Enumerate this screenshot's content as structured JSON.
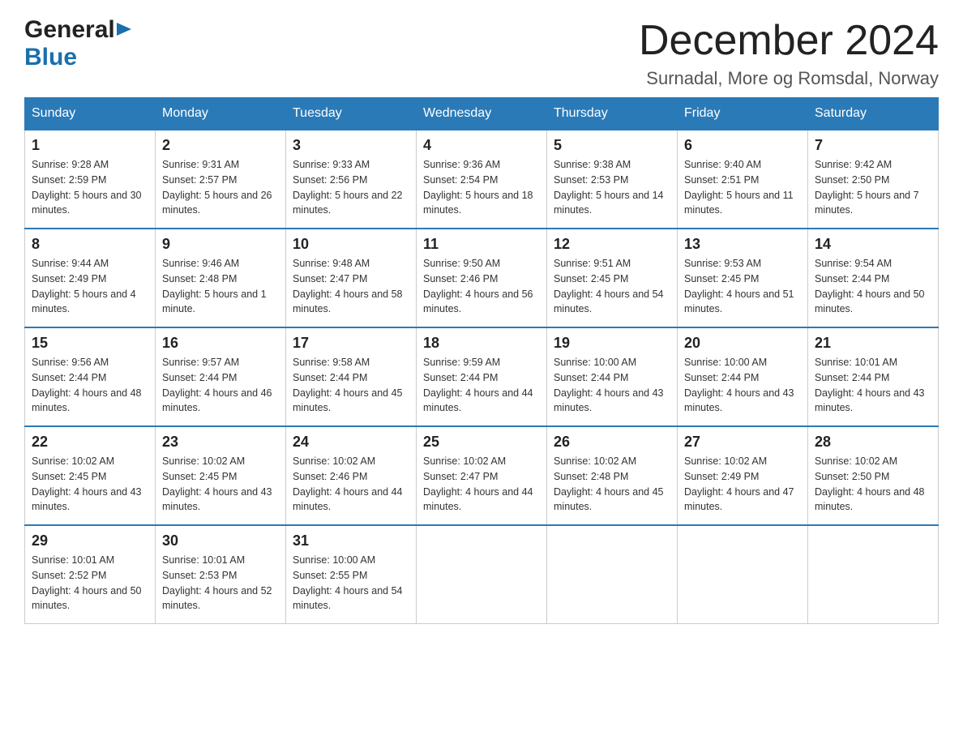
{
  "header": {
    "logo_part1": "General",
    "logo_part2": "Blue",
    "month_title": "December 2024",
    "location": "Surnadal, More og Romsdal, Norway"
  },
  "weekdays": [
    "Sunday",
    "Monday",
    "Tuesday",
    "Wednesday",
    "Thursday",
    "Friday",
    "Saturday"
  ],
  "weeks": [
    [
      {
        "day": "1",
        "sunrise": "9:28 AM",
        "sunset": "2:59 PM",
        "daylight": "5 hours and 30 minutes."
      },
      {
        "day": "2",
        "sunrise": "9:31 AM",
        "sunset": "2:57 PM",
        "daylight": "5 hours and 26 minutes."
      },
      {
        "day": "3",
        "sunrise": "9:33 AM",
        "sunset": "2:56 PM",
        "daylight": "5 hours and 22 minutes."
      },
      {
        "day": "4",
        "sunrise": "9:36 AM",
        "sunset": "2:54 PM",
        "daylight": "5 hours and 18 minutes."
      },
      {
        "day": "5",
        "sunrise": "9:38 AM",
        "sunset": "2:53 PM",
        "daylight": "5 hours and 14 minutes."
      },
      {
        "day": "6",
        "sunrise": "9:40 AM",
        "sunset": "2:51 PM",
        "daylight": "5 hours and 11 minutes."
      },
      {
        "day": "7",
        "sunrise": "9:42 AM",
        "sunset": "2:50 PM",
        "daylight": "5 hours and 7 minutes."
      }
    ],
    [
      {
        "day": "8",
        "sunrise": "9:44 AM",
        "sunset": "2:49 PM",
        "daylight": "5 hours and 4 minutes."
      },
      {
        "day": "9",
        "sunrise": "9:46 AM",
        "sunset": "2:48 PM",
        "daylight": "5 hours and 1 minute."
      },
      {
        "day": "10",
        "sunrise": "9:48 AM",
        "sunset": "2:47 PM",
        "daylight": "4 hours and 58 minutes."
      },
      {
        "day": "11",
        "sunrise": "9:50 AM",
        "sunset": "2:46 PM",
        "daylight": "4 hours and 56 minutes."
      },
      {
        "day": "12",
        "sunrise": "9:51 AM",
        "sunset": "2:45 PM",
        "daylight": "4 hours and 54 minutes."
      },
      {
        "day": "13",
        "sunrise": "9:53 AM",
        "sunset": "2:45 PM",
        "daylight": "4 hours and 51 minutes."
      },
      {
        "day": "14",
        "sunrise": "9:54 AM",
        "sunset": "2:44 PM",
        "daylight": "4 hours and 50 minutes."
      }
    ],
    [
      {
        "day": "15",
        "sunrise": "9:56 AM",
        "sunset": "2:44 PM",
        "daylight": "4 hours and 48 minutes."
      },
      {
        "day": "16",
        "sunrise": "9:57 AM",
        "sunset": "2:44 PM",
        "daylight": "4 hours and 46 minutes."
      },
      {
        "day": "17",
        "sunrise": "9:58 AM",
        "sunset": "2:44 PM",
        "daylight": "4 hours and 45 minutes."
      },
      {
        "day": "18",
        "sunrise": "9:59 AM",
        "sunset": "2:44 PM",
        "daylight": "4 hours and 44 minutes."
      },
      {
        "day": "19",
        "sunrise": "10:00 AM",
        "sunset": "2:44 PM",
        "daylight": "4 hours and 43 minutes."
      },
      {
        "day": "20",
        "sunrise": "10:00 AM",
        "sunset": "2:44 PM",
        "daylight": "4 hours and 43 minutes."
      },
      {
        "day": "21",
        "sunrise": "10:01 AM",
        "sunset": "2:44 PM",
        "daylight": "4 hours and 43 minutes."
      }
    ],
    [
      {
        "day": "22",
        "sunrise": "10:02 AM",
        "sunset": "2:45 PM",
        "daylight": "4 hours and 43 minutes."
      },
      {
        "day": "23",
        "sunrise": "10:02 AM",
        "sunset": "2:45 PM",
        "daylight": "4 hours and 43 minutes."
      },
      {
        "day": "24",
        "sunrise": "10:02 AM",
        "sunset": "2:46 PM",
        "daylight": "4 hours and 44 minutes."
      },
      {
        "day": "25",
        "sunrise": "10:02 AM",
        "sunset": "2:47 PM",
        "daylight": "4 hours and 44 minutes."
      },
      {
        "day": "26",
        "sunrise": "10:02 AM",
        "sunset": "2:48 PM",
        "daylight": "4 hours and 45 minutes."
      },
      {
        "day": "27",
        "sunrise": "10:02 AM",
        "sunset": "2:49 PM",
        "daylight": "4 hours and 47 minutes."
      },
      {
        "day": "28",
        "sunrise": "10:02 AM",
        "sunset": "2:50 PM",
        "daylight": "4 hours and 48 minutes."
      }
    ],
    [
      {
        "day": "29",
        "sunrise": "10:01 AM",
        "sunset": "2:52 PM",
        "daylight": "4 hours and 50 minutes."
      },
      {
        "day": "30",
        "sunrise": "10:01 AM",
        "sunset": "2:53 PM",
        "daylight": "4 hours and 52 minutes."
      },
      {
        "day": "31",
        "sunrise": "10:00 AM",
        "sunset": "2:55 PM",
        "daylight": "4 hours and 54 minutes."
      },
      null,
      null,
      null,
      null
    ]
  ]
}
